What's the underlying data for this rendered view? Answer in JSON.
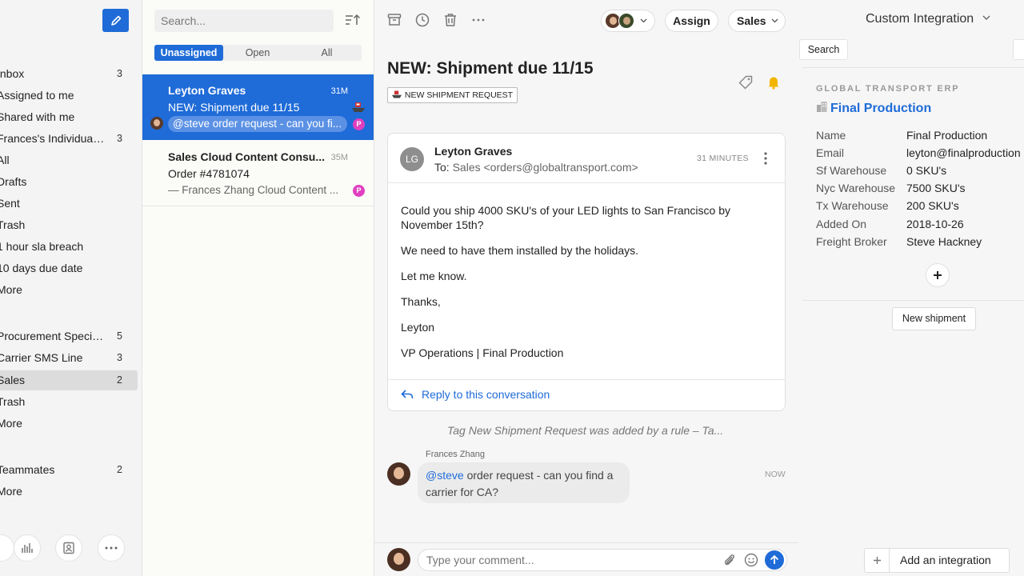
{
  "nav": {
    "items": [
      {
        "label": "Inbox",
        "count": "3"
      },
      {
        "label": "Assigned to me",
        "count": ""
      },
      {
        "label": "Shared with me",
        "count": ""
      },
      {
        "label": "Frances's Individual I...",
        "count": "3"
      },
      {
        "label": "All",
        "count": ""
      },
      {
        "label": "Drafts",
        "count": ""
      },
      {
        "label": "Sent",
        "count": ""
      },
      {
        "label": "Trash",
        "count": ""
      },
      {
        "label": "1 hour sla breach",
        "count": ""
      },
      {
        "label": "10 days due date",
        "count": ""
      },
      {
        "label": "More",
        "count": ""
      },
      {
        "label": "Procurement Specia...",
        "count": "5"
      },
      {
        "label": "Carrier SMS Line",
        "count": "3"
      },
      {
        "label": "Sales",
        "count": "2"
      },
      {
        "label": "Trash",
        "count": ""
      },
      {
        "label": "More",
        "count": ""
      },
      {
        "label": "Teammates",
        "count": "2"
      },
      {
        "label": "More",
        "count": ""
      }
    ]
  },
  "list": {
    "search_placeholder": "Search...",
    "tabs": [
      "Unassigned",
      "Open",
      "All"
    ],
    "conversations": [
      {
        "name": "Leyton Graves",
        "time": "31M",
        "subject": "NEW: Shipment due 11/15",
        "preview": "@steve order request - can you fi...",
        "badge": "P"
      },
      {
        "name": "Sales Cloud Content Consu...",
        "time": "35M",
        "subject": "Order #4781074",
        "preview": "— Frances Zhang Cloud Content ...",
        "badge": "P"
      }
    ]
  },
  "toolbar": {
    "assign_label": "Assign",
    "inbox_label": "Sales"
  },
  "message": {
    "subject": "NEW: Shipment due 11/15",
    "tag": "NEW SHIPMENT REQUEST",
    "avatar_initials": "LG",
    "from": "Leyton Graves",
    "to_label": "To:",
    "to_address": "Sales <orders@globaltransport.com>",
    "time": "31 MINUTES",
    "body": [
      "Could you ship 4000 SKU's of your LED lights to San Francisco by November 15th?",
      "We need to have them installed by the holidays.",
      "Let me know.",
      "Thanks,",
      "Leyton",
      "VP Operations | Final Production"
    ],
    "reply_label": "Reply to this conversation"
  },
  "activity": {
    "rule_note": "Tag New Shipment Request was added by a rule – Ta...",
    "comment_author": "Frances Zhang",
    "comment_mention": "@steve",
    "comment_text": " order request - can you find a carrier for CA?",
    "comment_time": "NOW"
  },
  "composer": {
    "placeholder": "Type your comment..."
  },
  "side": {
    "title": "Custom Integration",
    "search_label": "Search",
    "erp_title": "GLOBAL TRANSPORT ERP",
    "company": "Final Production",
    "fields": [
      {
        "key": "Name",
        "value": "Final Production"
      },
      {
        "key": "Email",
        "value": "leyton@finalproduction"
      },
      {
        "key": "Sf Warehouse",
        "value": "0 SKU's"
      },
      {
        "key": "Nyc Warehouse",
        "value": "7500 SKU's"
      },
      {
        "key": "Tx Warehouse",
        "value": "200 SKU's"
      },
      {
        "key": "Added On",
        "value": "2018-10-26"
      },
      {
        "key": "Freight Broker",
        "value": "Steve Hackney"
      }
    ],
    "new_shipment_label": "New shipment",
    "add_integration_label": "Add an integration"
  },
  "icons": {
    "compose": "pencil-icon",
    "sort": "sort-icon",
    "archive": "archive-icon",
    "snooze": "clock-icon",
    "delete": "trash-icon",
    "more": "ellipsis-icon",
    "tag": "tag-icon",
    "notify": "bell-icon"
  },
  "colors": {
    "accent": "#1f6bd8",
    "badge": "#e040c0",
    "bell": "#f2b500"
  }
}
